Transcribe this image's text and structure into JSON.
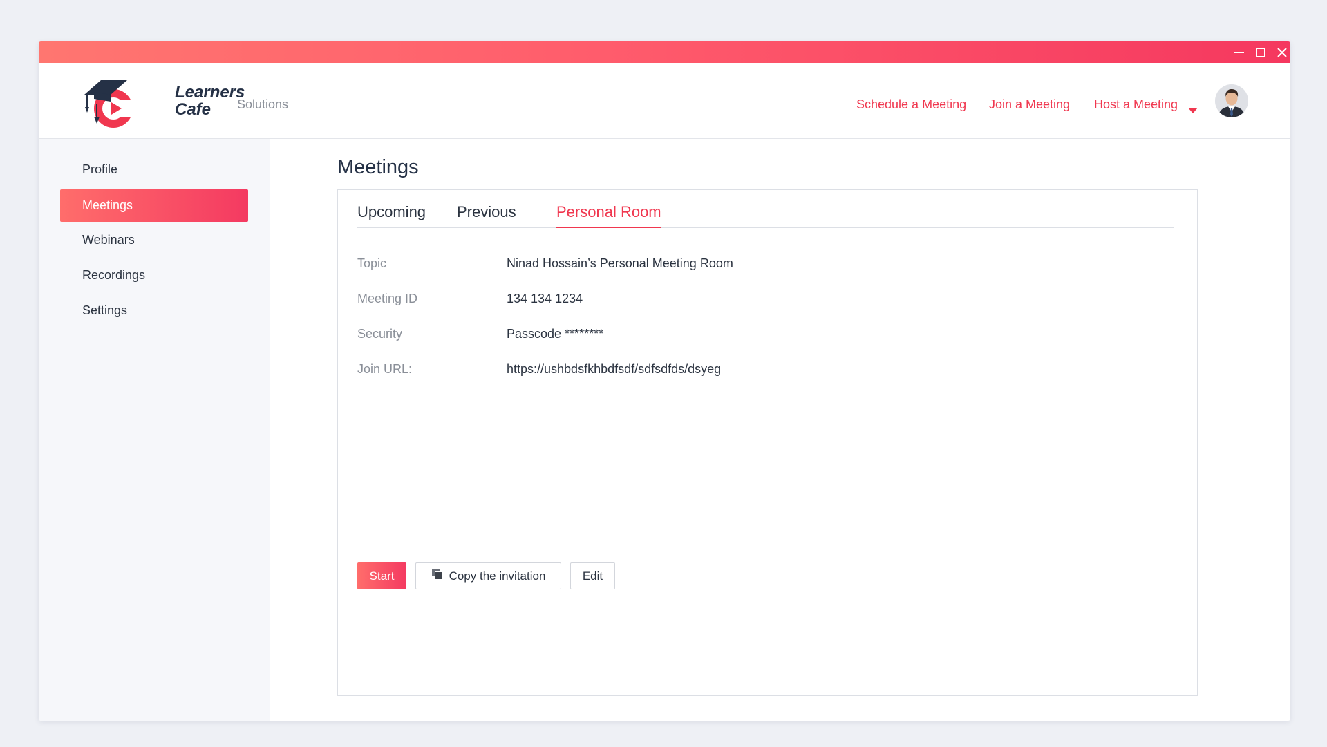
{
  "window_controls": {
    "minimize_icon": "minimize-icon",
    "maximize_icon": "maximize-icon",
    "close_icon": "close-icon"
  },
  "brand": {
    "line1": "Learners",
    "line2": "Cafe",
    "accent": "#f0374f",
    "dark": "#253146"
  },
  "header": {
    "solutions": "Solutions",
    "nav": {
      "schedule": "Schedule a Meeting",
      "join": "Join a Meeting",
      "host": "Host a Meeting"
    },
    "host_dropdown_icon": "caret-down-icon",
    "avatar_icon": "user-avatar"
  },
  "sidebar": {
    "items": [
      {
        "label": "Profile"
      },
      {
        "label": "Meetings"
      },
      {
        "label": "Webinars"
      },
      {
        "label": "Recordings"
      },
      {
        "label": "Settings"
      }
    ],
    "active_item": "Meetings"
  },
  "main": {
    "title": "Meetings",
    "tabs": [
      {
        "label": "Upcoming"
      },
      {
        "label": "Previous"
      },
      {
        "label": "Personal Room"
      }
    ],
    "active_tab": "Personal Room",
    "details": [
      {
        "label": "Topic",
        "value": "Ninad Hossain’s Personal Meeting Room"
      },
      {
        "label": "Meeting ID",
        "value": "134 134 1234"
      },
      {
        "label": "Security",
        "value": "Passcode ********"
      },
      {
        "label": "Join URL:",
        "value": "https://ushbdsfkhbdfsdf/sdfsdfds/dsyeg"
      }
    ],
    "actions": {
      "start": "Start",
      "copy": "Copy the invitation",
      "copy_icon": "copy-icon",
      "edit": "Edit"
    }
  }
}
